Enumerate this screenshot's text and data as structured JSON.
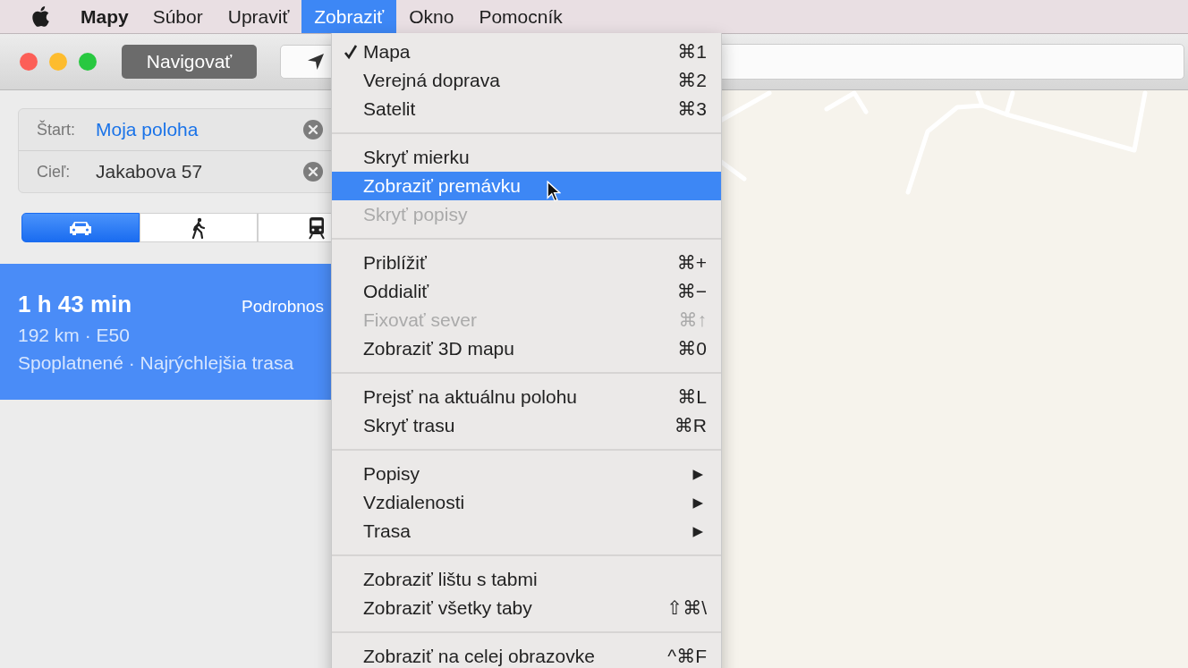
{
  "menu_bar": {
    "app": "Mapy",
    "menus": [
      {
        "label": "Súbor",
        "selected": false
      },
      {
        "label": "Upraviť",
        "selected": false
      },
      {
        "label": "Zobraziť",
        "selected": true
      },
      {
        "label": "Okno",
        "selected": false
      },
      {
        "label": "Pomocník",
        "selected": false
      }
    ]
  },
  "toolbar": {
    "navigate_button": "Navigovať"
  },
  "route_fields": [
    {
      "label": "Štart:",
      "value": "Moja poloha",
      "kind": "location"
    },
    {
      "label": "Cieľ:",
      "value": "Jakabova 57",
      "kind": "address"
    }
  ],
  "transport_modes": [
    {
      "kind": "car",
      "selected": true
    },
    {
      "kind": "walk",
      "selected": false
    },
    {
      "kind": "transit",
      "selected": false
    }
  ],
  "route": {
    "duration": "1 h 43 min",
    "details_link": "Podrobnos",
    "distance": "192 km · E50",
    "info": "Spoplatnené · Najrýchlejšia trasa",
    "selected": true
  },
  "view_menu": {
    "sections": [
      {
        "items": [
          {
            "label": "Mapa",
            "shortcut": "⌘1",
            "checked": true,
            "selected": false,
            "disabled": false
          },
          {
            "label": "Verejná doprava",
            "shortcut": "⌘2",
            "checked": false,
            "selected": false,
            "disabled": false
          },
          {
            "label": "Satelit",
            "shortcut": "⌘3",
            "checked": false,
            "selected": false,
            "disabled": false
          }
        ]
      },
      {
        "items": [
          {
            "label": "Skryť mierku",
            "checked": false,
            "selected": false,
            "disabled": false
          },
          {
            "label": "Zobraziť premávku",
            "checked": false,
            "selected": true,
            "disabled": false
          },
          {
            "label": "Skryť popisy",
            "checked": false,
            "selected": false,
            "disabled": true
          }
        ]
      },
      {
        "items": [
          {
            "label": "Priblížiť",
            "shortcut": "⌘+",
            "checked": false,
            "selected": false,
            "disabled": false
          },
          {
            "label": "Oddialiť",
            "shortcut": "⌘−",
            "checked": false,
            "selected": false,
            "disabled": false
          },
          {
            "label": "Fixovať sever",
            "shortcut": "⌘↑",
            "checked": false,
            "selected": false,
            "disabled": true
          },
          {
            "label": "Zobraziť 3D mapu",
            "shortcut": "⌘0",
            "checked": false,
            "selected": false,
            "disabled": false
          }
        ]
      },
      {
        "items": [
          {
            "label": "Prejsť na aktuálnu polohu",
            "shortcut": "⌘L",
            "checked": false,
            "selected": false,
            "disabled": false
          },
          {
            "label": "Skryť trasu",
            "shortcut": "⌘R",
            "checked": false,
            "selected": false,
            "disabled": false
          }
        ]
      },
      {
        "items": [
          {
            "label": "Popisy",
            "submenu": "▶",
            "checked": false,
            "selected": false,
            "disabled": false
          },
          {
            "label": "Vzdialenosti",
            "submenu": "▶",
            "checked": false,
            "selected": false,
            "disabled": false
          },
          {
            "label": "Trasa",
            "submenu": "▶",
            "checked": false,
            "selected": false,
            "disabled": false
          }
        ]
      },
      {
        "items": [
          {
            "label": "Zobraziť lištu s tabmi",
            "checked": false,
            "selected": false,
            "disabled": false
          },
          {
            "label": "Zobraziť všetky taby",
            "shortcut": "⇧⌘\\",
            "checked": false,
            "selected": false,
            "disabled": false
          }
        ]
      },
      {
        "items": [
          {
            "label": "Zobraziť na celej obrazovke",
            "shortcut": "^⌘F",
            "checked": false,
            "selected": false,
            "disabled": false
          }
        ]
      }
    ]
  }
}
